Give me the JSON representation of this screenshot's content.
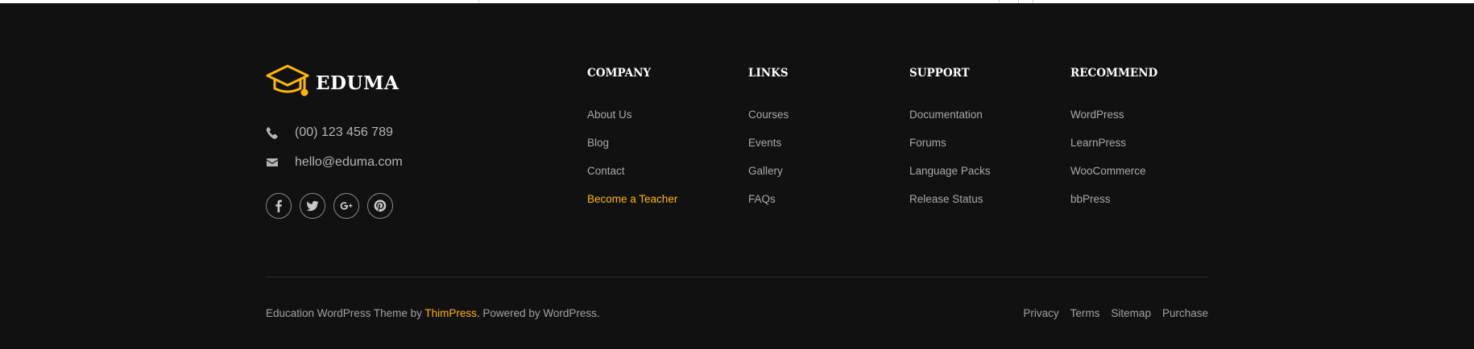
{
  "brand": {
    "logo_icon": "graduation-cap-icon",
    "name": "EDUMA",
    "accent_color": "#ffb606"
  },
  "contact": {
    "phone": "(00) 123 456 789",
    "email": "hello@eduma.com"
  },
  "socials": [
    {
      "name": "facebook-icon",
      "glyph": "f"
    },
    {
      "name": "twitter-icon",
      "glyph": "t"
    },
    {
      "name": "google-plus-icon",
      "glyph": "G+"
    },
    {
      "name": "pinterest-icon",
      "glyph": "p"
    }
  ],
  "columns": [
    {
      "title": "COMPANY",
      "items": [
        "About Us",
        "Blog",
        "Contact",
        "Become a Teacher"
      ]
    },
    {
      "title": "LINKS",
      "items": [
        "Courses",
        "Events",
        "Gallery",
        "FAQs"
      ]
    },
    {
      "title": "SUPPORT",
      "items": [
        "Documentation",
        "Forums",
        "Language Packs",
        "Release Status"
      ]
    },
    {
      "title": "RECOMMEND",
      "items": [
        "WordPress",
        "LearnPress",
        "WooCommerce",
        "bbPress"
      ]
    }
  ],
  "copyright": {
    "prefix": "Education WordPress Theme by ",
    "link": "ThimPress.",
    "suffix": " Powered by WordPress."
  },
  "bottom_links": [
    "Privacy",
    "Terms",
    "Sitemap",
    "Purchase"
  ]
}
